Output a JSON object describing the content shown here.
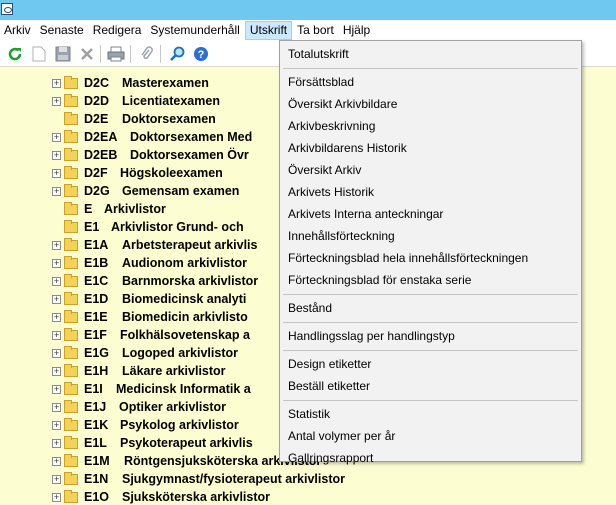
{
  "menubar": {
    "items": [
      {
        "label": "Arkiv"
      },
      {
        "label": "Senaste"
      },
      {
        "label": "Redigera"
      },
      {
        "label": "Systemunderhåll"
      },
      {
        "label": "Utskrift"
      },
      {
        "label": "Ta bort"
      },
      {
        "label": "Hjälp"
      }
    ],
    "active_index": 4
  },
  "toolbar": {
    "icons": [
      "refresh-icon",
      "new-document-icon",
      "save-icon",
      "delete-icon",
      "print-icon",
      "attach-icon",
      "search-icon",
      "help-icon"
    ]
  },
  "tree": {
    "rows": [
      {
        "code": "D2C",
        "label": "Masterexamen",
        "expandable": true
      },
      {
        "code": "D2D",
        "label": "Licentiatexamen",
        "expandable": true
      },
      {
        "code": "D2E",
        "label": "Doktorsexamen",
        "expandable": false
      },
      {
        "code": "D2EA",
        "label": "Doktorsexamen Med",
        "expandable": true
      },
      {
        "code": "D2EB",
        "label": "Doktorsexamen Övr",
        "expandable": true
      },
      {
        "code": "D2F",
        "label": "Högskoleexamen",
        "expandable": true
      },
      {
        "code": "D2G",
        "label": "Gemensam examen",
        "expandable": true
      },
      {
        "code": "E",
        "label": "Arkivlistor",
        "expandable": false
      },
      {
        "code": "E1",
        "label": "Arkivlistor Grund- och",
        "expandable": false
      },
      {
        "code": "E1A",
        "label": "Arbetsterapeut arkivlis",
        "expandable": true
      },
      {
        "code": "E1B",
        "label": "Audionom arkivlistor",
        "expandable": true
      },
      {
        "code": "E1C",
        "label": "Barnmorska arkivlistor",
        "expandable": true
      },
      {
        "code": "E1D",
        "label": "Biomedicinsk analyti",
        "expandable": true
      },
      {
        "code": "E1E",
        "label": "Biomedicin arkivlisto",
        "expandable": true
      },
      {
        "code": "E1F",
        "label": "Folkhälsovetenskap a",
        "expandable": true
      },
      {
        "code": "E1G",
        "label": "Logoped arkivlistor",
        "expandable": true
      },
      {
        "code": "E1H",
        "label": "Läkare arkivlistor",
        "expandable": true
      },
      {
        "code": "E1I",
        "label": "Medicinsk Informatik a",
        "expandable": true
      },
      {
        "code": "E1J",
        "label": "Optiker arkivlistor",
        "expandable": true
      },
      {
        "code": "E1K",
        "label": "Psykolog arkivlistor",
        "expandable": true
      },
      {
        "code": "E1L",
        "label": "Psykoterapeut arkivlis",
        "expandable": true
      },
      {
        "code": "E1M",
        "label": "Röntgensjuksköterska arkivlistor",
        "expandable": true
      },
      {
        "code": "E1N",
        "label": "Sjukgymnast/fysioterapeut arkivlistor",
        "expandable": true
      },
      {
        "code": "E1O",
        "label": "Sjuksköterska arkivlistor",
        "expandable": true
      }
    ]
  },
  "dropdown": {
    "groups": [
      [
        "Totalutskrift"
      ],
      [
        "Försättsblad",
        "Översikt Arkivbildare",
        "Arkivbeskrivning",
        "Arkivbildarens Historik",
        "Översikt Arkiv",
        "Arkivets Historik",
        "Arkivets Interna anteckningar",
        "Innehållsförteckning",
        "Förteckningsblad hela innehållsförteckningen",
        "Förteckningsblad för enstaka serie"
      ],
      [
        "Bestånd"
      ],
      [
        "Handlingsslag per handlingstyp"
      ],
      [
        "Design etiketter",
        "Beställ etiketter"
      ],
      [
        "Statistik",
        "Antal volymer per år",
        "Gallringsrapport"
      ]
    ]
  },
  "colors": {
    "titlebar": "#6ec8ef",
    "tree_background": "#fdfdd2",
    "menu_active": "#cce8ff",
    "dropdown_background": "#f2f2f2"
  }
}
